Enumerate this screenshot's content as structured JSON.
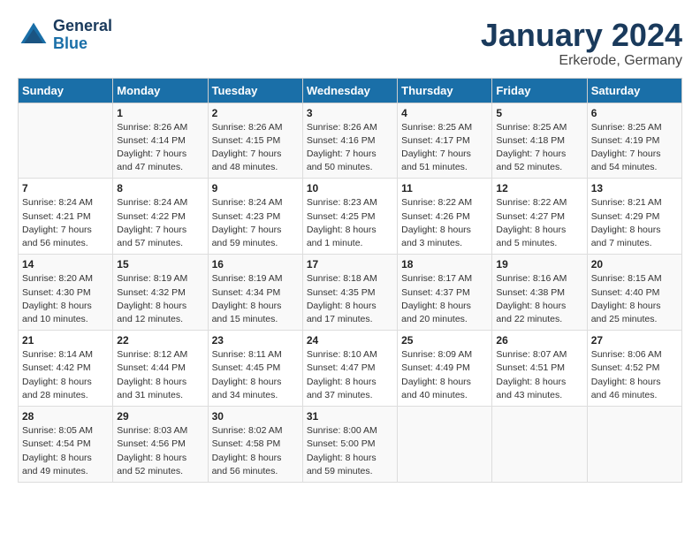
{
  "logo": {
    "general": "General",
    "blue": "Blue"
  },
  "title": "January 2024",
  "subtitle": "Erkerode, Germany",
  "days_of_week": [
    "Sunday",
    "Monday",
    "Tuesday",
    "Wednesday",
    "Thursday",
    "Friday",
    "Saturday"
  ],
  "weeks": [
    [
      {
        "day": "",
        "info": ""
      },
      {
        "day": "1",
        "info": "Sunrise: 8:26 AM\nSunset: 4:14 PM\nDaylight: 7 hours\nand 47 minutes."
      },
      {
        "day": "2",
        "info": "Sunrise: 8:26 AM\nSunset: 4:15 PM\nDaylight: 7 hours\nand 48 minutes."
      },
      {
        "day": "3",
        "info": "Sunrise: 8:26 AM\nSunset: 4:16 PM\nDaylight: 7 hours\nand 50 minutes."
      },
      {
        "day": "4",
        "info": "Sunrise: 8:25 AM\nSunset: 4:17 PM\nDaylight: 7 hours\nand 51 minutes."
      },
      {
        "day": "5",
        "info": "Sunrise: 8:25 AM\nSunset: 4:18 PM\nDaylight: 7 hours\nand 52 minutes."
      },
      {
        "day": "6",
        "info": "Sunrise: 8:25 AM\nSunset: 4:19 PM\nDaylight: 7 hours\nand 54 minutes."
      }
    ],
    [
      {
        "day": "7",
        "info": "Sunrise: 8:24 AM\nSunset: 4:21 PM\nDaylight: 7 hours\nand 56 minutes."
      },
      {
        "day": "8",
        "info": "Sunrise: 8:24 AM\nSunset: 4:22 PM\nDaylight: 7 hours\nand 57 minutes."
      },
      {
        "day": "9",
        "info": "Sunrise: 8:24 AM\nSunset: 4:23 PM\nDaylight: 7 hours\nand 59 minutes."
      },
      {
        "day": "10",
        "info": "Sunrise: 8:23 AM\nSunset: 4:25 PM\nDaylight: 8 hours\nand 1 minute."
      },
      {
        "day": "11",
        "info": "Sunrise: 8:22 AM\nSunset: 4:26 PM\nDaylight: 8 hours\nand 3 minutes."
      },
      {
        "day": "12",
        "info": "Sunrise: 8:22 AM\nSunset: 4:27 PM\nDaylight: 8 hours\nand 5 minutes."
      },
      {
        "day": "13",
        "info": "Sunrise: 8:21 AM\nSunset: 4:29 PM\nDaylight: 8 hours\nand 7 minutes."
      }
    ],
    [
      {
        "day": "14",
        "info": "Sunrise: 8:20 AM\nSunset: 4:30 PM\nDaylight: 8 hours\nand 10 minutes."
      },
      {
        "day": "15",
        "info": "Sunrise: 8:19 AM\nSunset: 4:32 PM\nDaylight: 8 hours\nand 12 minutes."
      },
      {
        "day": "16",
        "info": "Sunrise: 8:19 AM\nSunset: 4:34 PM\nDaylight: 8 hours\nand 15 minutes."
      },
      {
        "day": "17",
        "info": "Sunrise: 8:18 AM\nSunset: 4:35 PM\nDaylight: 8 hours\nand 17 minutes."
      },
      {
        "day": "18",
        "info": "Sunrise: 8:17 AM\nSunset: 4:37 PM\nDaylight: 8 hours\nand 20 minutes."
      },
      {
        "day": "19",
        "info": "Sunrise: 8:16 AM\nSunset: 4:38 PM\nDaylight: 8 hours\nand 22 minutes."
      },
      {
        "day": "20",
        "info": "Sunrise: 8:15 AM\nSunset: 4:40 PM\nDaylight: 8 hours\nand 25 minutes."
      }
    ],
    [
      {
        "day": "21",
        "info": "Sunrise: 8:14 AM\nSunset: 4:42 PM\nDaylight: 8 hours\nand 28 minutes."
      },
      {
        "day": "22",
        "info": "Sunrise: 8:12 AM\nSunset: 4:44 PM\nDaylight: 8 hours\nand 31 minutes."
      },
      {
        "day": "23",
        "info": "Sunrise: 8:11 AM\nSunset: 4:45 PM\nDaylight: 8 hours\nand 34 minutes."
      },
      {
        "day": "24",
        "info": "Sunrise: 8:10 AM\nSunset: 4:47 PM\nDaylight: 8 hours\nand 37 minutes."
      },
      {
        "day": "25",
        "info": "Sunrise: 8:09 AM\nSunset: 4:49 PM\nDaylight: 8 hours\nand 40 minutes."
      },
      {
        "day": "26",
        "info": "Sunrise: 8:07 AM\nSunset: 4:51 PM\nDaylight: 8 hours\nand 43 minutes."
      },
      {
        "day": "27",
        "info": "Sunrise: 8:06 AM\nSunset: 4:52 PM\nDaylight: 8 hours\nand 46 minutes."
      }
    ],
    [
      {
        "day": "28",
        "info": "Sunrise: 8:05 AM\nSunset: 4:54 PM\nDaylight: 8 hours\nand 49 minutes."
      },
      {
        "day": "29",
        "info": "Sunrise: 8:03 AM\nSunset: 4:56 PM\nDaylight: 8 hours\nand 52 minutes."
      },
      {
        "day": "30",
        "info": "Sunrise: 8:02 AM\nSunset: 4:58 PM\nDaylight: 8 hours\nand 56 minutes."
      },
      {
        "day": "31",
        "info": "Sunrise: 8:00 AM\nSunset: 5:00 PM\nDaylight: 8 hours\nand 59 minutes."
      },
      {
        "day": "",
        "info": ""
      },
      {
        "day": "",
        "info": ""
      },
      {
        "day": "",
        "info": ""
      }
    ]
  ]
}
